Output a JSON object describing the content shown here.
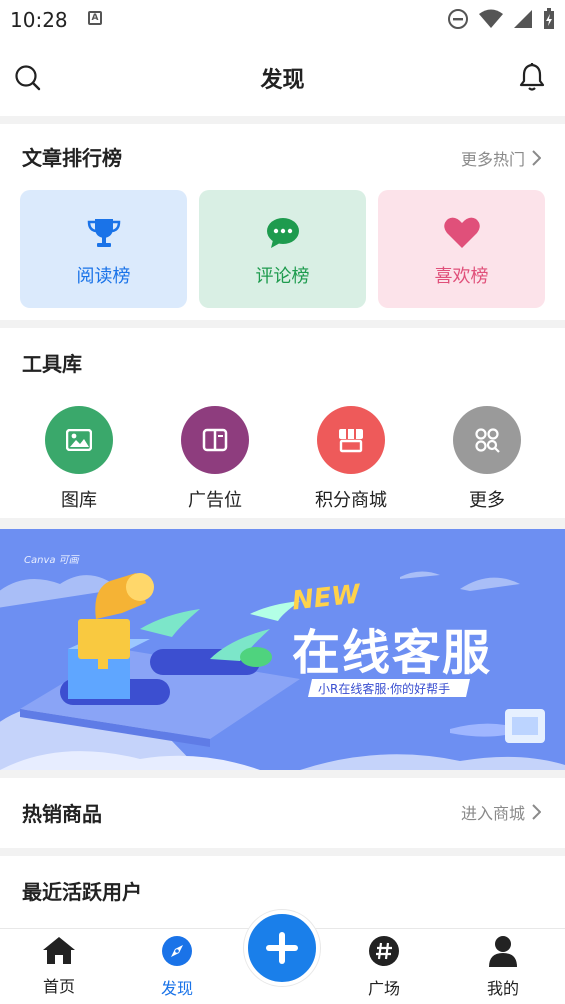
{
  "status": {
    "time": "10:28"
  },
  "header": {
    "title": "发现"
  },
  "rank": {
    "title": "文章排行榜",
    "more": "更多热门",
    "cards": [
      {
        "label": "阅读榜",
        "color": "#1a73e8",
        "bg": "#dbeafc",
        "icon": "trophy-icon"
      },
      {
        "label": "评论榜",
        "color": "#1e9b4e",
        "bg": "#d9efe4",
        "icon": "comment-icon"
      },
      {
        "label": "喜欢榜",
        "color": "#e0507a",
        "bg": "#fce3ea",
        "icon": "heart-icon"
      }
    ]
  },
  "tools": {
    "title": "工具库",
    "items": [
      {
        "label": "图库",
        "color": "#3aa86b",
        "icon": "image-icon"
      },
      {
        "label": "广告位",
        "color": "#8e3d7e",
        "icon": "book-icon"
      },
      {
        "label": "积分商城",
        "color": "#ee5a5a",
        "icon": "store-icon"
      },
      {
        "label": "更多",
        "color": "#9a9a9a",
        "icon": "grid-search-icon"
      }
    ]
  },
  "banner": {
    "brand": "Canva 可画",
    "new": "NEW",
    "title": "在线客服",
    "subtitle": "小R在线客服·你的好帮手"
  },
  "hot": {
    "title": "热销商品",
    "more": "进入商城"
  },
  "active": {
    "title": "最近活跃用户"
  },
  "tabs": [
    {
      "label": "首页",
      "icon": "home-icon"
    },
    {
      "label": "发现",
      "icon": "compass-icon",
      "active": true
    },
    {
      "label": "广场",
      "icon": "hashtag-icon"
    },
    {
      "label": "我的",
      "icon": "person-icon"
    }
  ],
  "fab": {
    "icon": "plus-icon"
  }
}
